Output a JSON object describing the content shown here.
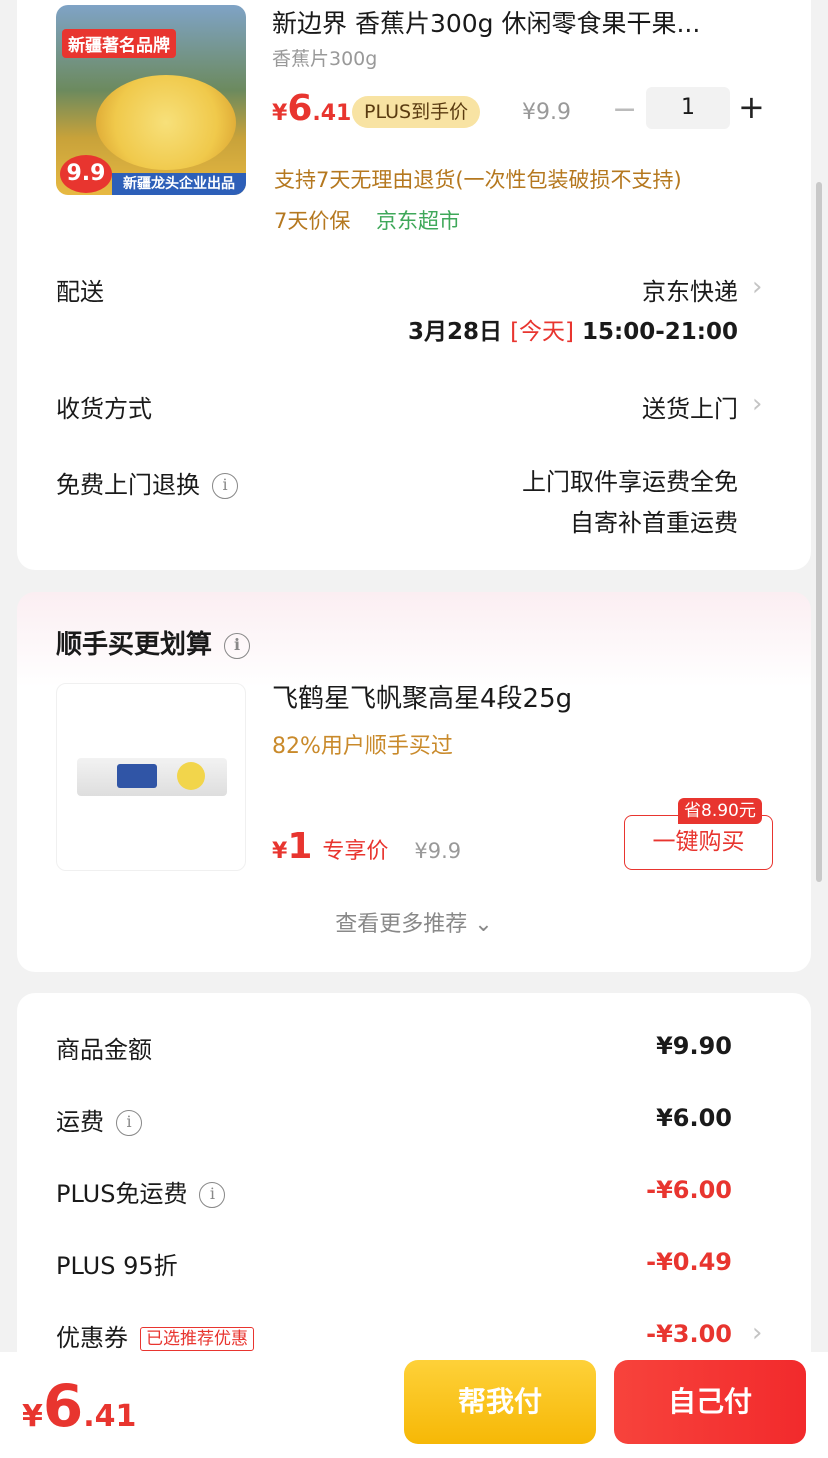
{
  "product": {
    "thumb_tag": "新疆著名品牌",
    "thumb_price": "9.9",
    "thumb_bottom": "新疆龙头企业出品",
    "title": "新边界 香蕉片300g 休闲零食果干果...",
    "spec": "香蕉片300g",
    "price_symbol": "¥",
    "price_int": "6",
    "price_dec": ".41",
    "plus_tag": "PLUS到手价",
    "orig_price": "¥9.9",
    "minus": "−",
    "qty": "1",
    "plus": "+",
    "return_notice": "支持7天无理由退货(一次性包装破损不支持)",
    "price_protect": "7天价保",
    "store": "京东超市"
  },
  "delivery": {
    "label": "配送",
    "value": "京东快递",
    "date": "3月28日",
    "today": "[今天]",
    "time": "15:00-21:00"
  },
  "receive": {
    "label": "收货方式",
    "value": "送货上门"
  },
  "free_return": {
    "label": "免费上门退换",
    "line1": "上门取件享运费全免",
    "line2": "自寄补首重运费"
  },
  "recommend": {
    "title": "顺手买更划算",
    "name": "飞鹤星飞帆聚高星4段25g",
    "pct": "82%用户顺手买过",
    "price_symbol": "¥",
    "price": "1",
    "price_tag": "专享价",
    "orig": "¥9.9",
    "save": "省8.90元",
    "buy_btn": "一键购买",
    "more": "查看更多推荐"
  },
  "summary": {
    "items": [
      {
        "label": "商品金额",
        "value": "¥9.90"
      },
      {
        "label": "运费",
        "value": "¥6.00"
      },
      {
        "label": "PLUS免运费",
        "value": "-¥6.00"
      },
      {
        "label": "PLUS 95折",
        "value": "-¥0.49"
      },
      {
        "label": "优惠券",
        "value": "-¥3.00",
        "tag": "已选推荐优惠"
      }
    ]
  },
  "bottom": {
    "symbol": "¥",
    "int": "6",
    "dec": ".41",
    "help_pay": "帮我付",
    "self_pay": "自己付"
  },
  "colors": {
    "accent": "#e8352f",
    "gold": "#f6b806",
    "green": "#3fa85a"
  },
  "icons": [
    "info-icon",
    "chevron-right-icon",
    "chevron-down-icon",
    "minus-icon",
    "plus-icon"
  ]
}
